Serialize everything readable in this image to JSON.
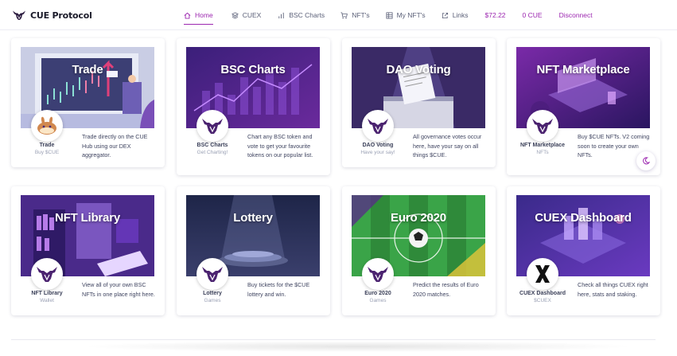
{
  "brand": {
    "name": "CUE Protocol"
  },
  "nav": {
    "home": "Home",
    "cuex": "CUEX",
    "bsc_charts": "BSC Charts",
    "nfts": "NFT's",
    "my_nfts": "My NFT's",
    "links": "Links",
    "price": "$72.22",
    "cue_balance": "0 CUE",
    "disconnect": "Disconnect"
  },
  "colors": {
    "accent": "#9c27b0",
    "text": "#3f4460",
    "muted": "#9aa0b4"
  },
  "cards": [
    {
      "title": "Trade",
      "name": "Trade",
      "sub": "Buy $CUE",
      "icon": "pancake-icon",
      "desc": "Trade directly on the CUE Hub using our DEX aggregator."
    },
    {
      "title": "BSC Charts",
      "name": "BSC Charts",
      "sub": "Get Charting!",
      "icon": "bull-icon",
      "desc": "Chart any BSC token and vote to get your favourite tokens on our popular list."
    },
    {
      "title": "DAO Voting",
      "name": "DAO Voting",
      "sub": "Have your say!",
      "icon": "bull-icon",
      "desc": "All governance votes occur here, have your say on all things $CUE."
    },
    {
      "title": "NFT Marketplace",
      "name": "NFT Marketplace",
      "sub": "NFTs",
      "icon": "bull-icon",
      "desc": "Buy $CUE NFTs. V2 coming soon to create your own NFTs."
    },
    {
      "title": "NFT Library",
      "name": "NFT Library",
      "sub": "Wallet",
      "icon": "bull-icon",
      "desc": "View all of your own BSC NFTs in one place right here."
    },
    {
      "title": "Lottery",
      "name": "Lottery",
      "sub": "Games",
      "icon": "bull-icon",
      "desc": "Buy tickets for the $CUE lottery and win."
    },
    {
      "title": "Euro 2020",
      "name": "Euro 2020",
      "sub": "Games",
      "icon": "bull-icon",
      "desc": "Predict the results of Euro 2020 matches."
    },
    {
      "title": "CUEX Dashboard",
      "name": "CUEX Dashboard",
      "sub": "$CUEX",
      "icon": "x-icon",
      "desc": "Check all things CUEX right here, stats and staking."
    }
  ]
}
